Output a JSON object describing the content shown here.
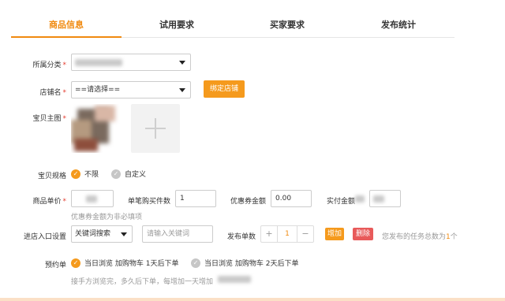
{
  "tabs": [
    "商品信息",
    "试用要求",
    "买家要求",
    "发布统计"
  ],
  "form": {
    "category": {
      "label": "所属分类",
      "required_mark": "*"
    },
    "shop": {
      "label": "店铺名",
      "required_mark": "*",
      "value": "==请选择==",
      "bind_button": "绑定店铺"
    },
    "main_image": {
      "label": "宝贝主图",
      "required_mark": "*"
    },
    "spec": {
      "label": "宝贝规格",
      "options": [
        "不限",
        "自定义"
      ],
      "selected": 0
    },
    "price": {
      "label": "商品单价",
      "required_mark": "*",
      "qty_label": "单笔购买件数",
      "qty_value": "1",
      "coupon_label": "优惠券金额",
      "coupon_value": "0.00",
      "actual_label": "实付金额",
      "coupon_hint": "优惠券金额为非必填项"
    },
    "entry": {
      "label": "进店入口设置",
      "mode": "关键词搜索",
      "keyword_placeholder": "请输入关键词",
      "count_label": "发布单数",
      "count_value": "1",
      "minus": "−",
      "plus": "+",
      "add_button": "增加",
      "delete_button": "删除",
      "total_prefix": "您发布的任务总数为",
      "total_value": "1",
      "total_suffix": "个"
    },
    "preorder": {
      "label": "预约单",
      "options": [
        "当日浏览 加购物车 1天后下单",
        "当日浏览 加购物车 2天后下单"
      ],
      "selected": 0,
      "hint": "接手方浏览完，多久后下单，每增加一天增加"
    }
  },
  "colors": {
    "accent": "#f08a10",
    "danger": "#e85a5a",
    "required": "#e43c2f"
  }
}
